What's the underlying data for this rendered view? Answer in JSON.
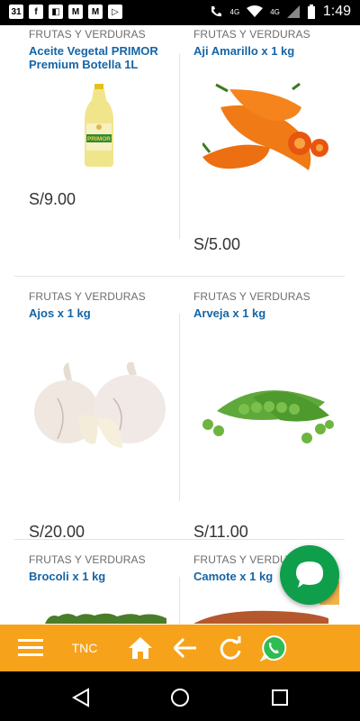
{
  "status_bar": {
    "time": "1:49",
    "calendar_day": "31",
    "network_label": "4G",
    "network_label_2": "4G"
  },
  "products": [
    {
      "category": "FRUTAS Y VERDURAS",
      "name": "Aceite Vegetal PRIMOR Premium Botella 1L",
      "price": "S/9.00",
      "brand": "PRIMOR"
    },
    {
      "category": "FRUTAS Y VERDURAS",
      "name": "Aji Amarillo x 1 kg",
      "price": "S/5.00"
    },
    {
      "category": "FRUTAS Y VERDURAS",
      "name": "Ajos x 1 kg",
      "price": "S/20.00"
    },
    {
      "category": "FRUTAS Y VERDURAS",
      "name": "Arveja x 1 kg",
      "price": "S/11.00"
    },
    {
      "category": "FRUTAS Y VERDURAS",
      "name": "Brocoli x 1 kg",
      "price": ""
    },
    {
      "category": "FRUTAS Y VERDURAS",
      "name": "Camote x 1 kg",
      "price": ""
    }
  ],
  "toolbar": {
    "tnc_label": "TNC",
    "icons": [
      "menu-icon",
      "home-icon",
      "back-arrow-icon",
      "refresh-icon",
      "whatsapp-icon"
    ]
  },
  "colors": {
    "accent": "#f7a21b",
    "link": "#1565a6",
    "chat": "#0f9f4b"
  }
}
